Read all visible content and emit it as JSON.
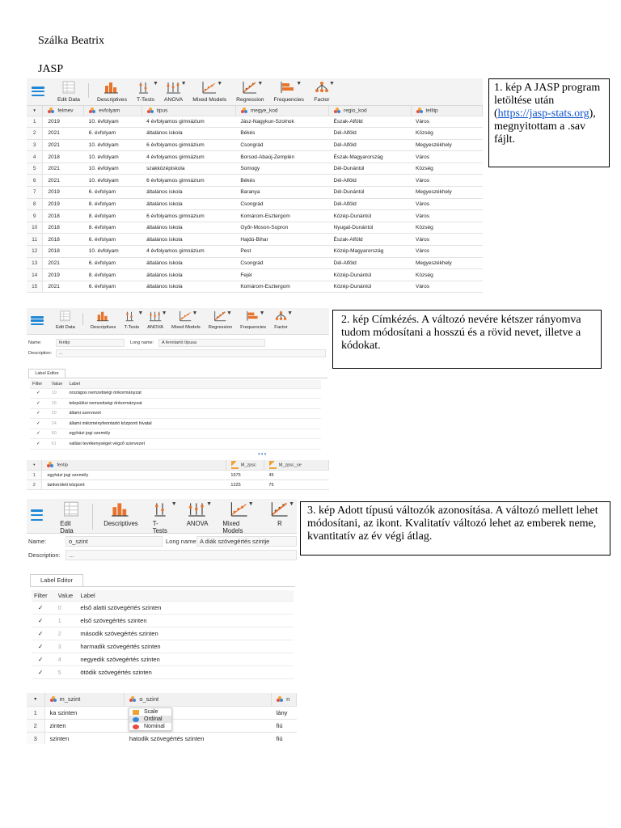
{
  "doc": {
    "author": "Szálka Beatrix",
    "subtitle": "JASP"
  },
  "callouts": {
    "c1": {
      "before": "1. kép A JASP program letöltése után (",
      "link": "https://jasp-stats.org",
      "after": "), megnyitottam a .sav fájlt."
    },
    "c2": "2. kép Címkézés. A változó nevére kétszer rányomva tudom módosítani a hosszú és a rövid nevet, illetve a kódokat.",
    "c3": "3. kép Adott típusú változók azonosítása. A változó mellett lehet módosítani, az ikont. Kvalitatív változó lehet az emberek neme, kvantitatív az év végi átlag."
  },
  "toolbar1": [
    "Edit Data",
    "Descriptives",
    "T-Tests",
    "ANOVA",
    "Mixed Models",
    "Regression",
    "Frequencies",
    "Factor"
  ],
  "toolbar3": [
    "Edit Data",
    "Descriptives",
    "T-Tests",
    "ANOVA",
    "Mixed Models",
    "R"
  ],
  "shot1": {
    "headers": [
      "felmev",
      "evfolyam",
      "tipus",
      "megye_kod",
      "regio_kod",
      "telltip"
    ],
    "rows": [
      [
        "1",
        "2019",
        "10. évfolyam",
        "4 évfolyamos gimnázium",
        "Jász-Nagykun-Szolnok",
        "Észak-Alföld",
        "Város"
      ],
      [
        "2",
        "2021",
        "6. évfolyam",
        "általános iskola",
        "Békés",
        "Dél-Alföld",
        "Község"
      ],
      [
        "3",
        "2021",
        "10. évfolyam",
        "6 évfolyamos gimnázium",
        "Csongrád",
        "Dél-Alföld",
        "Megyeszékhely"
      ],
      [
        "4",
        "2018",
        "10. évfolyam",
        "4 évfolyamos gimnázium",
        "Borsod-Abaúj-Zemplén",
        "Észak-Magyarország",
        "Város"
      ],
      [
        "5",
        "2021",
        "10. évfolyam",
        "szakközépiskola",
        "Somogy",
        "Dél-Dunántúl",
        "Község"
      ],
      [
        "6",
        "2021",
        "10. évfolyam",
        "6 évfolyamos gimnázium",
        "Békés",
        "Dél-Alföld",
        "Város"
      ],
      [
        "7",
        "2019",
        "6. évfolyam",
        "általános iskola",
        "Baranya",
        "Dél-Dunántúl",
        "Megyeszékhely"
      ],
      [
        "8",
        "2019",
        "8. évfolyam",
        "általános iskola",
        "Csongrád",
        "Dél-Alföld",
        "Város"
      ],
      [
        "9",
        "2018",
        "8. évfolyam",
        "6 évfolyamos gimnázium",
        "Komárom-Esztergom",
        "Közép-Dunántúl",
        "Város"
      ],
      [
        "10",
        "2018",
        "8. évfolyam",
        "általános iskola",
        "Győr-Moson-Sopron",
        "Nyugat-Dunántúl",
        "Község"
      ],
      [
        "11",
        "2018",
        "6. évfolyam",
        "általános iskola",
        "Hajdú-Bihar",
        "Észak-Alföld",
        "Város"
      ],
      [
        "12",
        "2018",
        "10. évfolyam",
        "4 évfolyamos gimnázium",
        "Pest",
        "Közép-Magyarország",
        "Város"
      ],
      [
        "13",
        "2021",
        "6. évfolyam",
        "általános iskola",
        "Csongrád",
        "Dél-Alföld",
        "Megyeszékhely"
      ],
      [
        "14",
        "2019",
        "8. évfolyam",
        "általános iskola",
        "Fejér",
        "Közép-Dunántúl",
        "Község"
      ],
      [
        "15",
        "2021",
        "6. évfolyam",
        "általános iskola",
        "Komárom-Esztergom",
        "Közép-Dunántúl",
        "Város"
      ]
    ]
  },
  "shot2": {
    "name_label": "Name:",
    "name_value": "fentip",
    "long_label": "Long name:",
    "long_value": "A fenntartó típusa",
    "desc_label": "Description:",
    "desc_value": "...",
    "tab": "Label Editor",
    "le_headers": [
      "Filter",
      "Value",
      "Label"
    ],
    "le_rows": [
      [
        "✓",
        "10",
        "országos nemzetiségi önkormányzat"
      ],
      [
        "✓",
        "16",
        "települési nemzetiségi önkormányzat"
      ],
      [
        "✓",
        "20",
        "állami szervezet"
      ],
      [
        "✓",
        "24",
        "állami intézményfenntartó központi hivatal"
      ],
      [
        "✓",
        "60",
        "egyházi jogi személy"
      ],
      [
        "✓",
        "61",
        "vallási tevékenységet végző szervezet"
      ]
    ],
    "grid_headers": [
      "fentip",
      "M_zpsc",
      "M_zpsc_se"
    ],
    "grid_rows": [
      [
        "1",
        "egyházi jogi személy",
        "1675",
        "45"
      ],
      [
        "2",
        "tankerületi központ",
        "1225",
        "76"
      ]
    ]
  },
  "shot3": {
    "name_label": "Name:",
    "name_value": "o_szint",
    "long_label": "Long name:",
    "long_value": "A diák szövegértés szintje",
    "desc_label": "Description:",
    "desc_value": "...",
    "tab": "Label Editor",
    "le_headers": [
      "Filter",
      "Value",
      "Label"
    ],
    "le_rows": [
      [
        "✓",
        "0",
        "első alatti szövegértés szinten"
      ],
      [
        "✓",
        "1",
        "első szövegértés szinten"
      ],
      [
        "✓",
        "2",
        "második szövegértés szinten"
      ],
      [
        "✓",
        "3",
        "harmadik szövegértés szinten"
      ],
      [
        "✓",
        "4",
        "negyedik szövegértés szinten"
      ],
      [
        "✓",
        "5",
        "ötödik szövegértés szinten"
      ]
    ],
    "grid_headers": [
      "m_szint",
      "o_szint",
      "n"
    ],
    "grid_rows": [
      [
        "1",
        "ka szinten",
        "értés szinten",
        "lány"
      ],
      [
        "2",
        "zinten",
        "értés szinten",
        "fiú"
      ],
      [
        "3",
        "szinten",
        "hatodik szövegértés szinten",
        "fiú"
      ]
    ],
    "menu": [
      "Scale",
      "Ordinal",
      "Nominal"
    ]
  }
}
